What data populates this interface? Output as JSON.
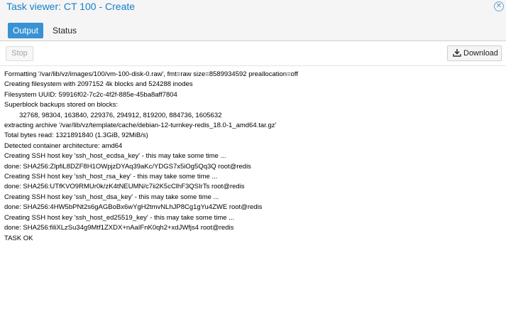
{
  "window": {
    "title": "Task viewer: CT 100 - Create",
    "close_icon": "close-icon"
  },
  "tabs": [
    {
      "label": "Output",
      "active": true
    },
    {
      "label": "Status",
      "active": false
    }
  ],
  "toolbar": {
    "stop_label": "Stop",
    "stop_disabled": true,
    "download_label": "Download",
    "download_icon": "download-icon"
  },
  "log": [
    "Formatting '/var/lib/vz/images/100/vm-100-disk-0.raw', fmt=raw size=8589934592 preallocation=off",
    "Creating filesystem with 2097152 4k blocks and 524288 inodes",
    "Filesystem UUID: 59916f02-7c2c-4f2f-885e-45ba8aff7804",
    "Superblock backups stored on blocks:",
    "        32768, 98304, 163840, 229376, 294912, 819200, 884736, 1605632",
    "extracting archive '/var/lib/vz/template/cache/debian-12-turnkey-redis_18.0-1_amd64.tar.gz'",
    "Total bytes read: 1321891840 (1.3GiB, 92MiB/s)",
    "Detected container architecture: amd64",
    "Creating SSH host key 'ssh_host_ecdsa_key' - this may take some time ...",
    "done: SHA256:ZlpfiL8DZF8H1OWpjzDYAq39aKc/YDGS7x5iOg5Qq3Q root@redis",
    "Creating SSH host key 'ssh_host_rsa_key' - this may take some time ...",
    "done: SHA256:UTfKVO9RMUr0k/zK4tNEUMN/c7ii2K5cClhF3QSIrTs root@redis",
    "Creating SSH host key 'ssh_host_dsa_key' - this may take some time ...",
    "done: SHA256:4HW5bPNt2s6gAGBoBx6wYgH2tmvNLhJP8Cg1gYu4ZWE root@redis",
    "Creating SSH host key 'ssh_host_ed25519_key' - this may take some time ...",
    "done: SHA256:filiXLzSu34g9Mtf1ZXDX+nAaIFnK0qh2+xdJWfjs4 root@redis",
    "TASK OK"
  ],
  "colors": {
    "accent": "#157fcc",
    "active_tab": "#3892d4"
  }
}
